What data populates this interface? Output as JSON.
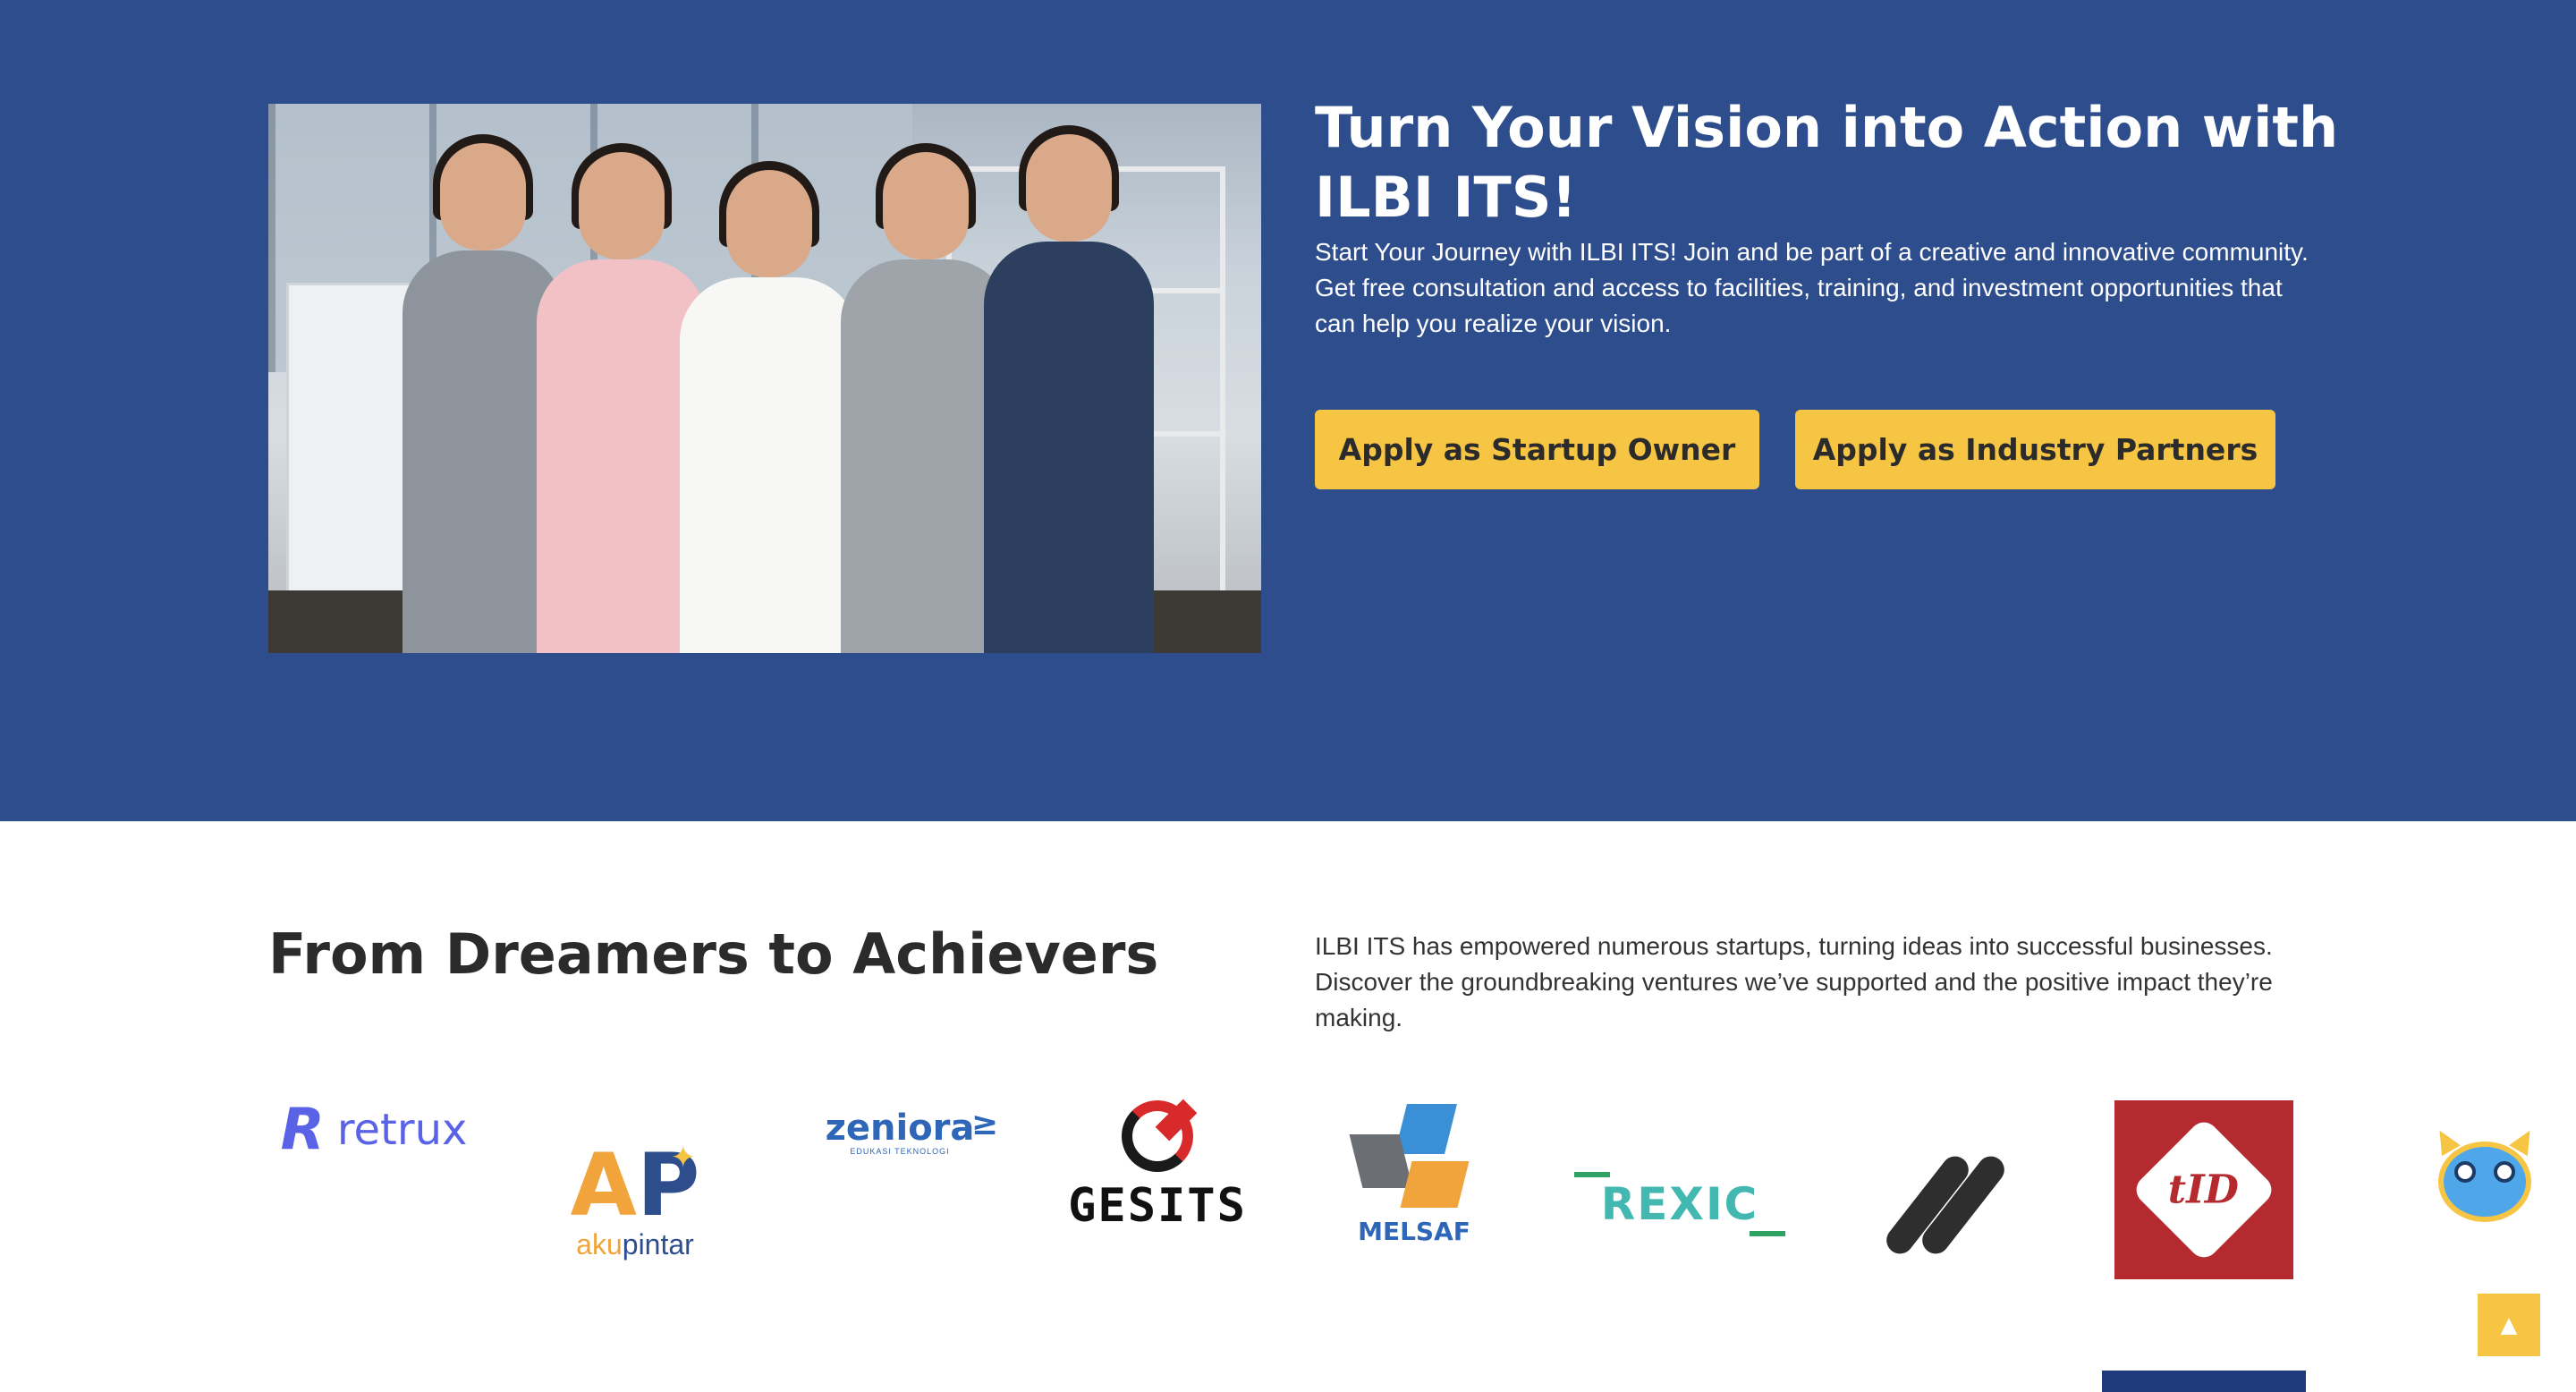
{
  "hero": {
    "title": "Turn Your Vision into Action with ILBI ITS!",
    "description": "Start Your Journey with ILBI ITS! Join and be part of a creative and innovative community. Get free consultation and access to facilities, training, and investment opportunities that can help you realize your vision.",
    "buttons": {
      "startup_label": "Apply as Startup Owner",
      "partner_label": "Apply as Industry Partners"
    }
  },
  "achievers": {
    "title": "From Dreamers to Achievers",
    "description": "ILBI ITS has empowered numerous startups, turning ideas into successful businesses. Discover the groundbreaking ventures we’ve supported and the positive impact they’re making.",
    "logos": [
      {
        "name": "retrux",
        "mark": "R",
        "text": "retrux"
      },
      {
        "name": "akupintar",
        "mark_a": "A",
        "mark_p": "P",
        "text_aku": "aku",
        "text_pintar": "pintar"
      },
      {
        "name": "zeniora",
        "text": "zeniora",
        "sub": "EDUKASI TEKNOLOGI"
      },
      {
        "name": "gesits",
        "text": "GESITS"
      },
      {
        "name": "melsaf",
        "text": "MELSAF"
      },
      {
        "name": "rexic",
        "text": "REXIC"
      },
      {
        "name": "slash-logo"
      },
      {
        "name": "tid",
        "text": "tID"
      }
    ]
  },
  "floating": {
    "chatbot_icon": "robot-icon",
    "scroll_top_icon": "arrow-up-icon",
    "scroll_top_glyph": "▲"
  },
  "colors": {
    "hero_bg": "#2e4d8c",
    "button_bg": "#f7c544",
    "heading_dark": "#2b2b2b"
  }
}
